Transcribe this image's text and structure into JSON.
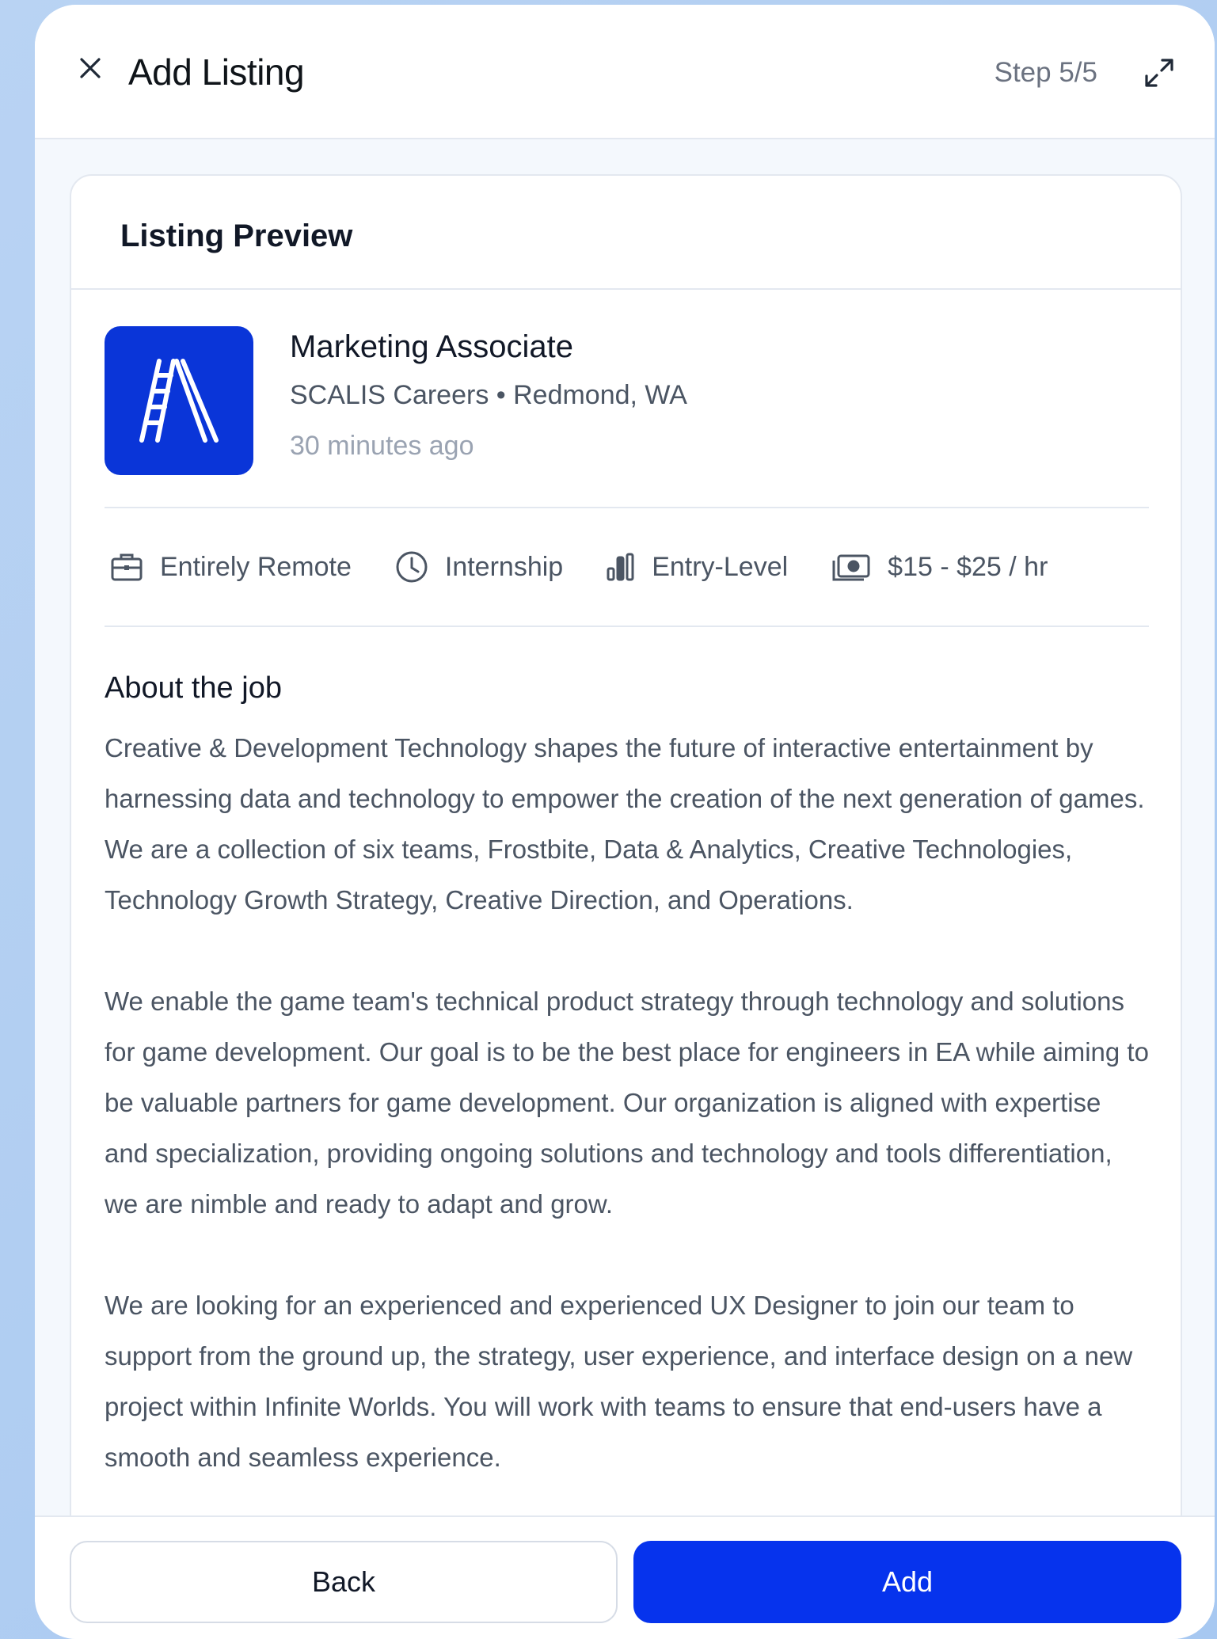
{
  "header": {
    "title": "Add Listing",
    "step": "Step 5/5"
  },
  "preview": {
    "title": "Listing Preview"
  },
  "job": {
    "title": "Marketing Associate",
    "company_location": "SCALIS Careers • Redmond, WA",
    "posted": "30 minutes ago",
    "logo_color": "#0a35d8"
  },
  "tags": [
    {
      "icon": "briefcase-icon",
      "label": "Entirely Remote"
    },
    {
      "icon": "clock-icon",
      "label": "Internship"
    },
    {
      "icon": "bar-chart-icon",
      "label": "Entry-Level"
    },
    {
      "icon": "money-icon",
      "label": "$15 - $25 / hr"
    }
  ],
  "about": {
    "heading": "About the job",
    "paragraphs": [
      "Creative & Development Technology shapes the future of interactive entertainment by harnessing data and technology to empower the creation of the next generation of games. We are a collection of six teams, Frostbite, Data & Analytics, Creative Technologies, Technology Growth Strategy, Creative Direction, and Operations.",
      "We enable the game team's technical product strategy through technology and solutions for game development. Our goal is to be the best place for engineers in EA while aiming to be valuable partners for game development. Our organization is aligned with expertise and specialization, providing ongoing solutions and technology and tools differentiation, we are nimble and ready to adapt and grow.",
      "We are looking for an experienced and experienced UX Designer to join our team to support from the ground up, the strategy, user experience, and interface design on a new project within Infinite Worlds. You will work with teams to ensure that end-users have a smooth and seamless experience."
    ]
  },
  "footer": {
    "back_label": "Back",
    "add_label": "Add",
    "accent": "#0633ed"
  }
}
